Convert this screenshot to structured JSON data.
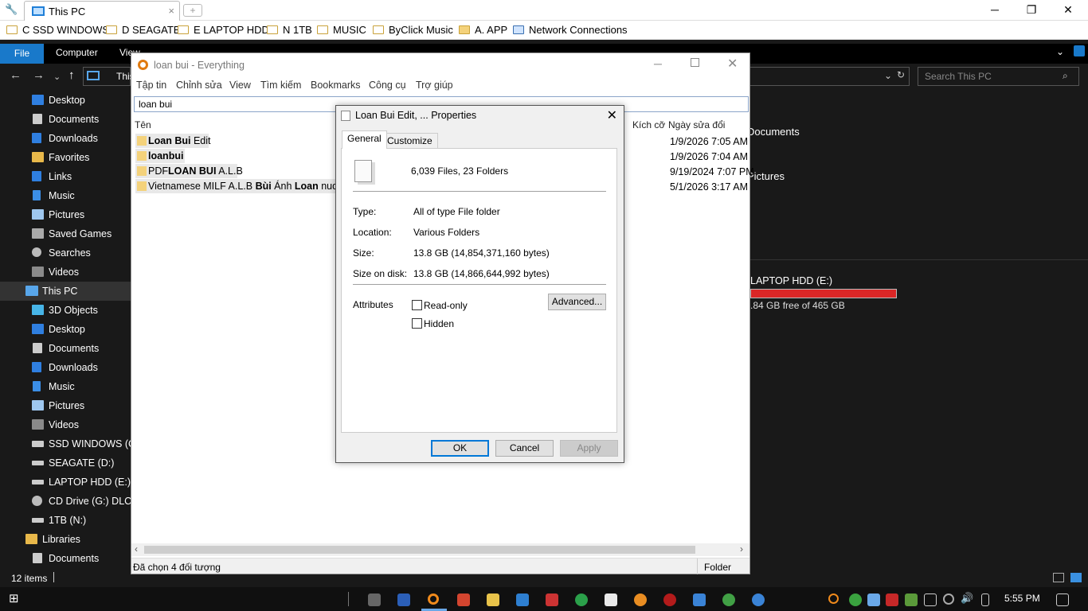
{
  "browser": {
    "tab_title": "This PC",
    "close": "×",
    "new_tab": "+",
    "minimize": "─",
    "restore": "❐",
    "close_window": "✕"
  },
  "favorites": [
    "C SSD WINDOWS",
    "D SEAGATE",
    "E LAPTOP HDD",
    "N 1TB",
    "MUSIC",
    "ByClick Music",
    "A. APP",
    "Network Connections"
  ],
  "explorer": {
    "ribbon": {
      "file": "File",
      "computer": "Computer",
      "view": "View"
    },
    "address_partial": "This",
    "search_placeholder": "Search This PC",
    "sidebar": [
      "Desktop",
      "Documents",
      "Downloads",
      "Favorites",
      "Links",
      "Music",
      "Pictures",
      "Saved Games",
      "Searches",
      "Videos",
      "This PC",
      "3D Objects",
      "Desktop",
      "Documents",
      "Downloads",
      "Music",
      "Pictures",
      "Videos",
      "SSD WINDOWS  (C:)",
      "SEAGATE (D:)",
      "LAPTOP HDD (E:)",
      "CD Drive (G:) DLC B",
      "1TB (N:)",
      "Libraries",
      "Documents"
    ],
    "right": {
      "documents": "Documents",
      "pictures": "Pictures",
      "drive_name": "LAPTOP HDD (E:)",
      "drive_free": ".84 GB free of 465 GB",
      "drive_color": "#da2626"
    },
    "status": {
      "items": "12 items"
    }
  },
  "everything": {
    "title": "loan  bui - Everything",
    "menu": [
      "Tập tin",
      "Chỉnh sửa",
      "View",
      "Tìm kiếm",
      "Bookmarks",
      "Công cụ",
      "Trợ giúp"
    ],
    "search_value": "loan  bui",
    "columns": {
      "name": "Tên",
      "size": "Kích cỡ",
      "date": "Ngày sửa đổi"
    },
    "rows": [
      {
        "name_bold": "Loan Bui",
        "name_rest": " Edit",
        "date": "1/9/2026 7:05 AM"
      },
      {
        "name_bold": "loanbui",
        "name_rest": "",
        "date": "1/9/2026 7:04 AM"
      },
      {
        "name_pre": "PDF",
        "name_bold": "LOAN BUI",
        "name_rest": " A.L.B",
        "date": "9/19/2024 7:07 PM"
      },
      {
        "name_pre": "Vietnamese MILF A.L.B ",
        "name_bold": "Bùi",
        "name_mid": " Ánh ",
        "name_bold2": "Loan",
        "name_rest": " nude le",
        "date": "5/1/2026 3:17 AM"
      }
    ],
    "status_left": "Đã chọn 4 đối tượng",
    "status_right": "Folder"
  },
  "dialog": {
    "title": "Loan Bui Edit, ... Properties",
    "tabs": [
      "General",
      "Customize"
    ],
    "summary": "6,039 Files, 23 Folders",
    "type_label": "Type:",
    "type_value": "All of type File folder",
    "location_label": "Location:",
    "location_value": "Various Folders",
    "size_label": "Size:",
    "size_value": "13.8 GB (14,854,371,160 bytes)",
    "disk_label": "Size on disk:",
    "disk_value": "13.8 GB (14,866,644,992 bytes)",
    "attributes_label": "Attributes",
    "readonly": "Read-only",
    "hidden": "Hidden",
    "advanced": "Advanced...",
    "ok": "OK",
    "cancel": "Cancel",
    "apply": "Apply"
  },
  "taskbar": {
    "time": "5:55 PM"
  }
}
